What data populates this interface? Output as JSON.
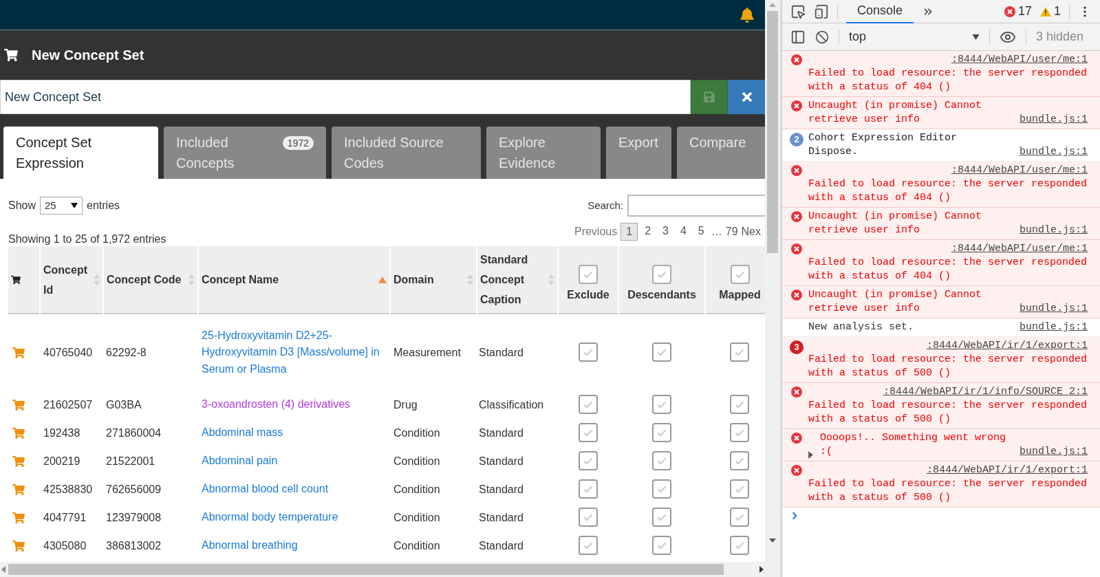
{
  "header": {
    "title": "New Concept Set"
  },
  "name_field": {
    "value": "New Concept Set"
  },
  "tabs": [
    {
      "label": "Concept Set Expression",
      "selected": true
    },
    {
      "label": "Included Concepts",
      "badge": "1972",
      "selected": false
    },
    {
      "label": "Included Source Codes",
      "selected": false
    },
    {
      "label": "Explore Evidence",
      "selected": false
    },
    {
      "label": "Export",
      "selected": false
    },
    {
      "label": "Compare",
      "selected": false
    }
  ],
  "table_controls": {
    "show_label": "Show",
    "page_size": "25",
    "entries_label": "entries",
    "search_label": "Search:",
    "info": "Showing 1 to 25 of 1,972 entries"
  },
  "pagination": {
    "previous": "Previous",
    "pages": [
      {
        "label": "1",
        "selected": true
      },
      {
        "label": "2",
        "selected": false
      },
      {
        "label": "3",
        "selected": false
      },
      {
        "label": "4",
        "selected": false
      },
      {
        "label": "5",
        "selected": false
      }
    ],
    "ellipsis": "…",
    "last": "79",
    "next": "Nex"
  },
  "table": {
    "columns": [
      {
        "kind": "icon"
      },
      {
        "kind": "text",
        "label": "Concept Id",
        "sortable": true,
        "sorted": false
      },
      {
        "kind": "text",
        "label": "Concept Code",
        "sortable": true,
        "sorted": false
      },
      {
        "kind": "text",
        "label": "Concept Name",
        "sortable": true,
        "sorted": true
      },
      {
        "kind": "text",
        "label": "Domain",
        "sortable": true,
        "sorted": false
      },
      {
        "kind": "text",
        "label": "Standard Concept Caption",
        "sortable": true,
        "sorted": false
      },
      {
        "kind": "check",
        "label": "Exclude",
        "checked": false
      },
      {
        "kind": "check",
        "label": "Descendants",
        "checked": false
      },
      {
        "kind": "check",
        "label": "Mapped",
        "checked": false
      }
    ],
    "rows": [
      {
        "concept_id": "40765040",
        "concept_code": "62292-8",
        "concept_name": "25-Hydroxyvitamin D2+25-Hydroxyvitamin D3 [Mass/volume] in Serum or Plasma",
        "visited": false,
        "domain": "Measurement",
        "standard": "Standard",
        "exclude": false,
        "descendants": false,
        "mapped": false
      },
      {
        "concept_id": "21602507",
        "concept_code": "G03BA",
        "concept_name": "3-oxoandrosten (4) derivatives",
        "visited": true,
        "domain": "Drug",
        "standard": "Classification",
        "exclude": false,
        "descendants": false,
        "mapped": false
      },
      {
        "concept_id": "192438",
        "concept_code": "271860004",
        "concept_name": "Abdominal mass",
        "visited": false,
        "domain": "Condition",
        "standard": "Standard",
        "exclude": false,
        "descendants": false,
        "mapped": false
      },
      {
        "concept_id": "200219",
        "concept_code": "21522001",
        "concept_name": "Abdominal pain",
        "visited": false,
        "domain": "Condition",
        "standard": "Standard",
        "exclude": false,
        "descendants": false,
        "mapped": false
      },
      {
        "concept_id": "42538830",
        "concept_code": "762656009",
        "concept_name": "Abnormal blood cell count",
        "visited": false,
        "domain": "Condition",
        "standard": "Standard",
        "exclude": false,
        "descendants": false,
        "mapped": false
      },
      {
        "concept_id": "4047791",
        "concept_code": "123979008",
        "concept_name": "Abnormal body temperature",
        "visited": false,
        "domain": "Condition",
        "standard": "Standard",
        "exclude": false,
        "descendants": false,
        "mapped": false
      },
      {
        "concept_id": "4305080",
        "concept_code": "386813002",
        "concept_name": "Abnormal breathing",
        "visited": false,
        "domain": "Condition",
        "standard": "Standard",
        "exclude": false,
        "descendants": false,
        "mapped": false
      }
    ]
  },
  "devtools": {
    "tab": "Console",
    "error_count": "17",
    "warning_count": "1",
    "context": "top",
    "hidden": "3 hidden",
    "messages": [
      {
        "kind": "error",
        "text": "Failed to load resource: the server responded with a status of 404 ()",
        "source": ":8444/WebAPI/user/me:1"
      },
      {
        "kind": "error",
        "text": "Uncaught (in promise) Cannot retrieve user info",
        "source": "bundle.js:1"
      },
      {
        "kind": "info",
        "count": "2",
        "text": "Cohort Expression Editor Dispose.",
        "source": "bundle.js:1"
      },
      {
        "kind": "error",
        "text": "Failed to load resource: the server responded with a status of 404 ()",
        "source": ":8444/WebAPI/user/me:1"
      },
      {
        "kind": "error",
        "text": "Uncaught (in promise) Cannot retrieve user info",
        "source": "bundle.js:1"
      },
      {
        "kind": "error",
        "text": "Failed to load resource: the server responded with a status of 404 ()",
        "source": ":8444/WebAPI/user/me:1"
      },
      {
        "kind": "error",
        "text": "Uncaught (in promise) Cannot retrieve user info",
        "source": "bundle.js:1"
      },
      {
        "kind": "log",
        "text": "New analysis set.",
        "source": "bundle.js:1"
      },
      {
        "kind": "error",
        "count": "3",
        "text": "Failed to load resource: the server responded with a status of 500 ()",
        "source": ":8444/WebAPI/ir/1/export:1"
      },
      {
        "kind": "error",
        "text": "Failed to load resource: the server responded with a status of 500 ()",
        "source": ":8444/WebAPI/ir/1/info/SOURCE_2:1"
      },
      {
        "kind": "error",
        "expandable": true,
        "text": "Oooops!.. Something went wrong :(",
        "source": "bundle.js:1"
      },
      {
        "kind": "error",
        "text": "Failed to load resource: the server responded with a status of 500 ()",
        "source": ":8444/WebAPI/ir/1/export:1"
      }
    ]
  }
}
